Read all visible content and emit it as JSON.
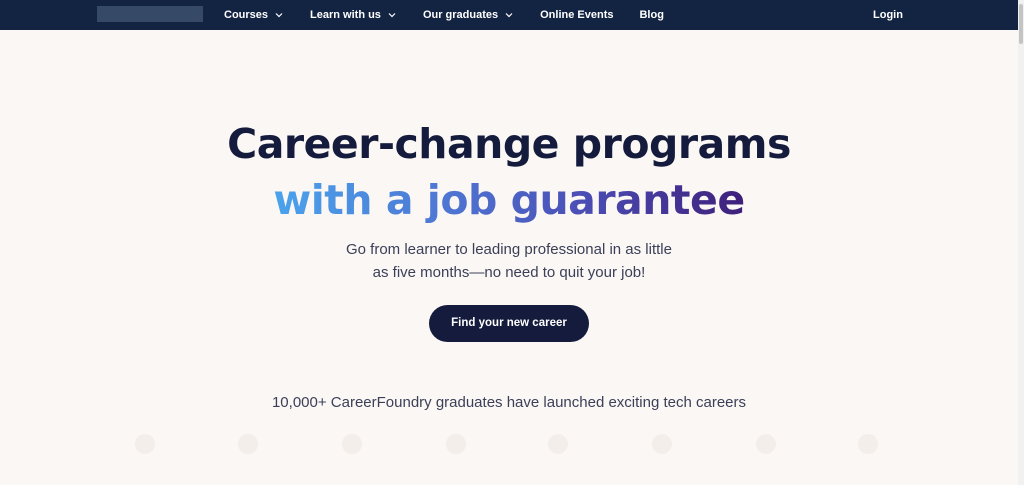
{
  "nav": {
    "items": [
      {
        "label": "Courses",
        "has_dropdown": true
      },
      {
        "label": "Learn with us",
        "has_dropdown": true
      },
      {
        "label": "Our graduates",
        "has_dropdown": true
      },
      {
        "label": "Online Events",
        "has_dropdown": false
      },
      {
        "label": "Blog",
        "has_dropdown": false
      }
    ],
    "login_label": "Login"
  },
  "hero": {
    "headline_line1": "Career-change programs",
    "headline_line2": "with a job guarantee",
    "subtitle_line1": "Go from learner to leading professional in as little",
    "subtitle_line2": "as five months—no need to quit your job!",
    "cta_label": "Find your new career",
    "graduates_text": "10,000+ CareerFoundry graduates have launched exciting tech careers"
  },
  "colors": {
    "nav_bg": "#132442",
    "page_bg": "#fbf7f4",
    "text_dark": "#141b3c",
    "gradient_start": "#4aa3ec",
    "gradient_end": "#3e1f7a"
  },
  "icons": {
    "dropdown": "chevron-down-icon"
  }
}
